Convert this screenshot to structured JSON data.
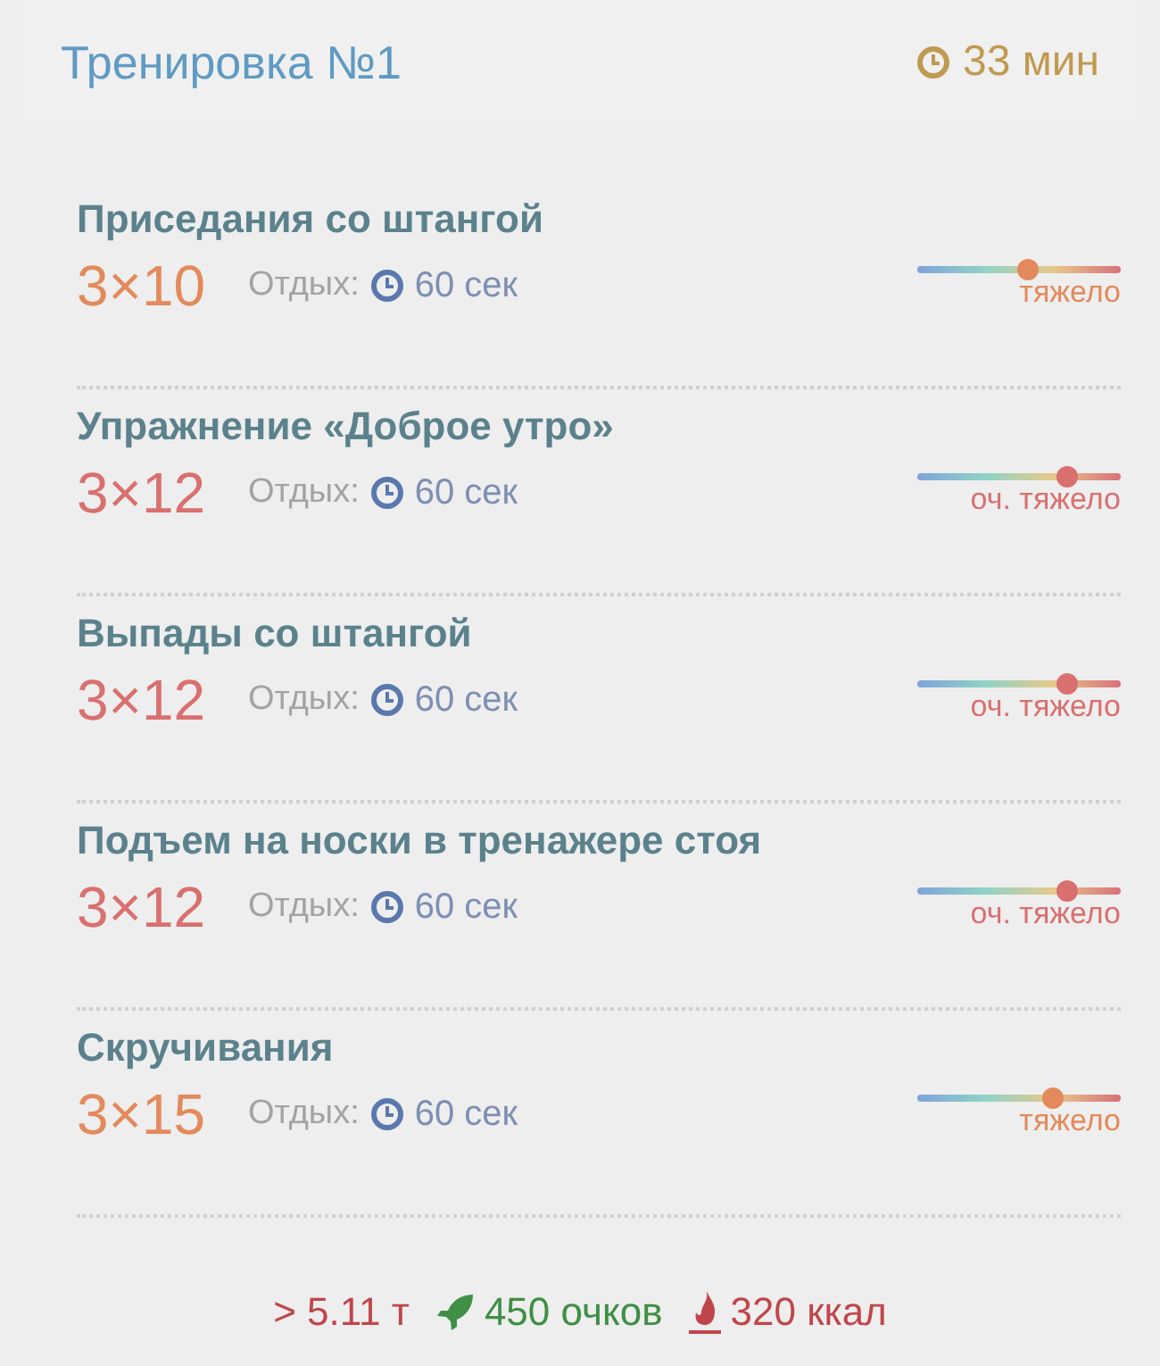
{
  "header": {
    "title": "Тренировка №1",
    "duration": "33 мин"
  },
  "exercises": [
    {
      "name": "Приседания со штангой",
      "sets": "3×10",
      "rest_label": "Отдых:",
      "rest": "60 сек",
      "kind": "hard",
      "level": 0.54,
      "difficulty": "тяжело"
    },
    {
      "name": "Упражнение «Доброе утро»",
      "sets": "3×12",
      "rest_label": "Отдых:",
      "rest": "60 сек",
      "kind": "very_hard",
      "level": 0.74,
      "difficulty": "оч. тяжело"
    },
    {
      "name": "Выпады со штангой",
      "sets": "3×12",
      "rest_label": "Отдых:",
      "rest": "60 сек",
      "kind": "very_hard",
      "level": 0.74,
      "difficulty": "оч. тяжело"
    },
    {
      "name": "Подъем на носки в тренажере стоя",
      "sets": "3×12",
      "rest_label": "Отдых:",
      "rest": "60 сек",
      "kind": "very_hard",
      "level": 0.74,
      "difficulty": "оч. тяжело"
    },
    {
      "name": "Скручивания",
      "sets": "3×15",
      "rest_label": "Отдых:",
      "rest": "60 сек",
      "kind": "hard",
      "level": 0.67,
      "difficulty": "тяжело"
    }
  ],
  "summary": {
    "weight": "> 5.11 т",
    "points": "450 очков",
    "calories": "320 ккал"
  }
}
